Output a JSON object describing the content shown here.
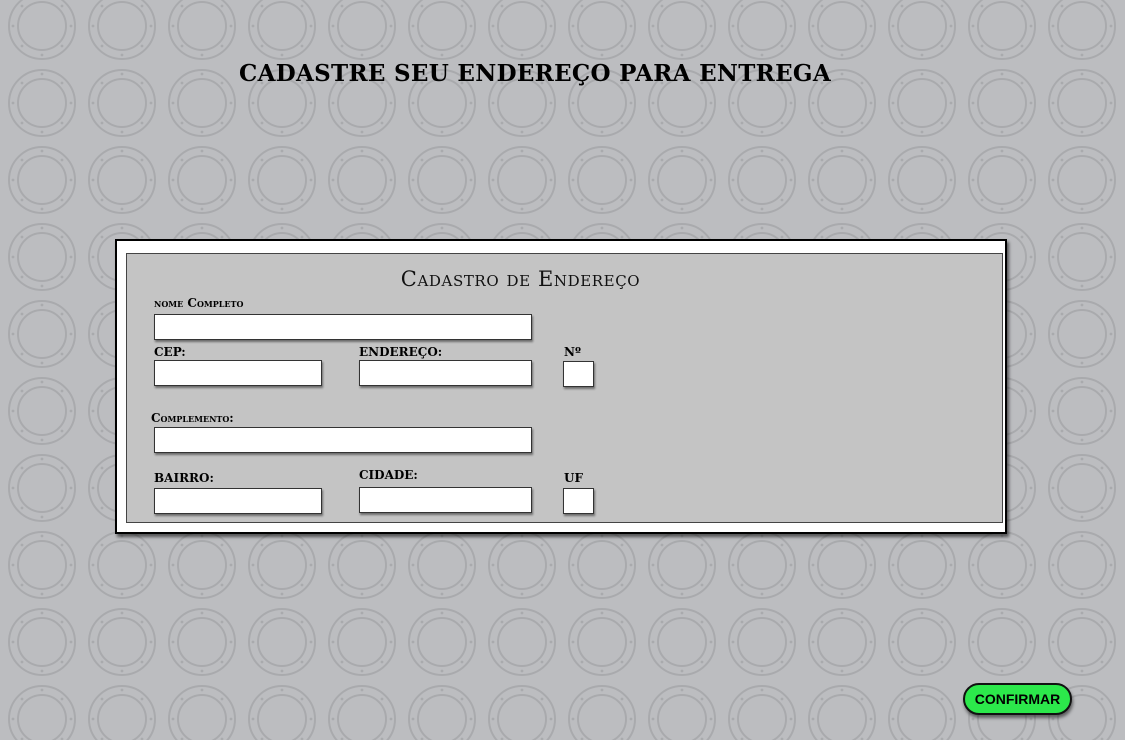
{
  "page": {
    "title": "CADASTRE SEU ENDEREÇO PARA ENTREGA",
    "background_color": "#bcbdc0",
    "background_pattern": "porthole-circle-icon"
  },
  "form": {
    "title": "Cadastro de Endereço",
    "fields": {
      "nome": {
        "label": "nome Completo",
        "value": ""
      },
      "cep": {
        "label": "CEP:",
        "value": ""
      },
      "endereco": {
        "label": "ENDEREÇO:",
        "value": ""
      },
      "numero": {
        "label": "Nº",
        "value": ""
      },
      "complemento": {
        "label": "Complemento:",
        "value": ""
      },
      "bairro": {
        "label": "BAIRRO:",
        "value": ""
      },
      "cidade": {
        "label": "CIDADE:",
        "value": ""
      },
      "uf": {
        "label": "UF",
        "value": ""
      }
    }
  },
  "actions": {
    "confirm_label": "CONFIRMAR",
    "confirm_color": "#2ce84b"
  }
}
